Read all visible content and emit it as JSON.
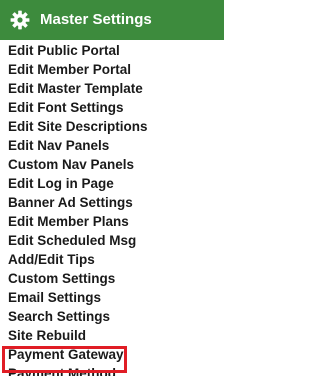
{
  "header": {
    "title": "Master Settings",
    "icon": "gear-icon",
    "background_color": "#3d8b3d"
  },
  "menu": {
    "items": [
      {
        "label": "Edit Public Portal"
      },
      {
        "label": "Edit Member Portal"
      },
      {
        "label": "Edit Master Template"
      },
      {
        "label": "Edit Font Settings"
      },
      {
        "label": "Edit Site Descriptions"
      },
      {
        "label": "Edit Nav Panels"
      },
      {
        "label": "Custom Nav Panels"
      },
      {
        "label": "Edit Log in Page"
      },
      {
        "label": "Banner Ad Settings"
      },
      {
        "label": "Edit Member Plans"
      },
      {
        "label": "Edit Scheduled Msg"
      },
      {
        "label": "Add/Edit Tips"
      },
      {
        "label": "Custom Settings"
      },
      {
        "label": "Email Settings"
      },
      {
        "label": "Search Settings"
      },
      {
        "label": "Site Rebuild"
      },
      {
        "label": "Payment Gateway"
      },
      {
        "label": "Payment Method"
      }
    ]
  },
  "highlight": {
    "target": "Payment Gateway",
    "color": "#e01d25"
  }
}
